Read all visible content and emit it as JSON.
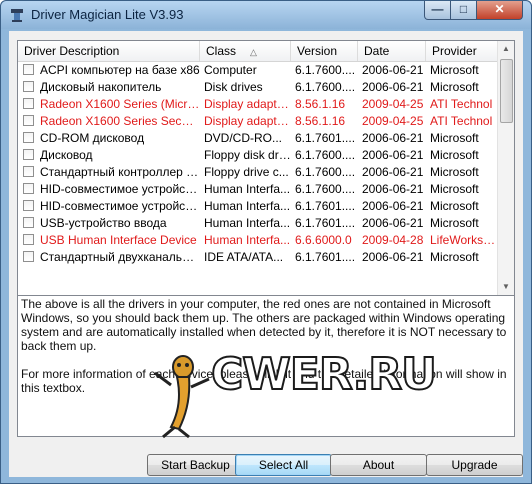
{
  "window": {
    "title": "Driver Magician Lite V3.93"
  },
  "columns": [
    {
      "label": "Driver Description"
    },
    {
      "label": "Class",
      "sort": "ascending"
    },
    {
      "label": "Version"
    },
    {
      "label": "Date"
    },
    {
      "label": "Provider"
    }
  ],
  "drivers": [
    {
      "desc": "ACPI компьютер на базе x86",
      "cls": "Computer",
      "ver": "6.1.7600....",
      "date": "2006-06-21",
      "prov": "Microsoft",
      "red": false
    },
    {
      "desc": "Дисковый накопитель",
      "cls": "Disk drives",
      "ver": "6.1.7600....",
      "date": "2006-06-21",
      "prov": "Microsoft",
      "red": false
    },
    {
      "desc": "Radeon X1600 Series (Microsof...",
      "cls": "Display adapters",
      "ver": "8.56.1.16",
      "date": "2009-04-25",
      "prov": "ATI Technol",
      "red": true
    },
    {
      "desc": "Radeon X1600 Series Seconda...",
      "cls": "Display adapters",
      "ver": "8.56.1.16",
      "date": "2009-04-25",
      "prov": "ATI Technol",
      "red": true
    },
    {
      "desc": "CD-ROM дисковод",
      "cls": "DVD/CD-RO...",
      "ver": "6.1.7601....",
      "date": "2006-06-21",
      "prov": "Microsoft",
      "red": false
    },
    {
      "desc": "Дисковод",
      "cls": "Floppy disk dri...",
      "ver": "6.1.7600....",
      "date": "2006-06-21",
      "prov": "Microsoft",
      "red": false
    },
    {
      "desc": "Стандартный контроллер гиб...",
      "cls": "Floppy drive c...",
      "ver": "6.1.7600....",
      "date": "2006-06-21",
      "prov": "Microsoft",
      "red": false
    },
    {
      "desc": "HID-совместимое устройство...",
      "cls": "Human Interfa...",
      "ver": "6.1.7600....",
      "date": "2006-06-21",
      "prov": "Microsoft",
      "red": false
    },
    {
      "desc": "HID-совместимое устройство",
      "cls": "Human Interfa...",
      "ver": "6.1.7601....",
      "date": "2006-06-21",
      "prov": "Microsoft",
      "red": false
    },
    {
      "desc": "USB-устройство ввода",
      "cls": "Human Interfa...",
      "ver": "6.1.7601....",
      "date": "2006-06-21",
      "prov": "Microsoft",
      "red": false
    },
    {
      "desc": "USB Human Interface Device",
      "cls": "Human Interfa...",
      "ver": "6.6.6000.0",
      "date": "2009-04-28",
      "prov": "LifeWorks Te",
      "red": true
    },
    {
      "desc": "Стандартный двухканальный...",
      "cls": "IDE ATA/ATA...",
      "ver": "6.1.7601....",
      "date": "2006-06-21",
      "prov": "Microsoft",
      "red": false
    }
  ],
  "info": {
    "paragraph1": "The above is all the drivers in your computer, the red ones are not contained in Microsoft Windows, so you should back them up. The others are packaged within Windows operating system and are automatically installed when detected by it, therefore it is NOT necessary to back them up.",
    "paragraph2": "For more information of each device, please click it and the detailed information will show in this textbox."
  },
  "watermark": {
    "text": "CWER.RU"
  },
  "buttons": {
    "start_backup": "Start Backup",
    "select_all": "Select All",
    "about": "About",
    "upgrade": "Upgrade"
  },
  "colors": {
    "driver_not_in_windows": "#e01a1a",
    "title_bar": "#8cb3d8",
    "close_button": "#c2412a"
  },
  "icons": {
    "app": "driver-magician-icon",
    "minimize": "minimize-icon",
    "maximize": "maximize-icon",
    "close": "close-icon"
  }
}
